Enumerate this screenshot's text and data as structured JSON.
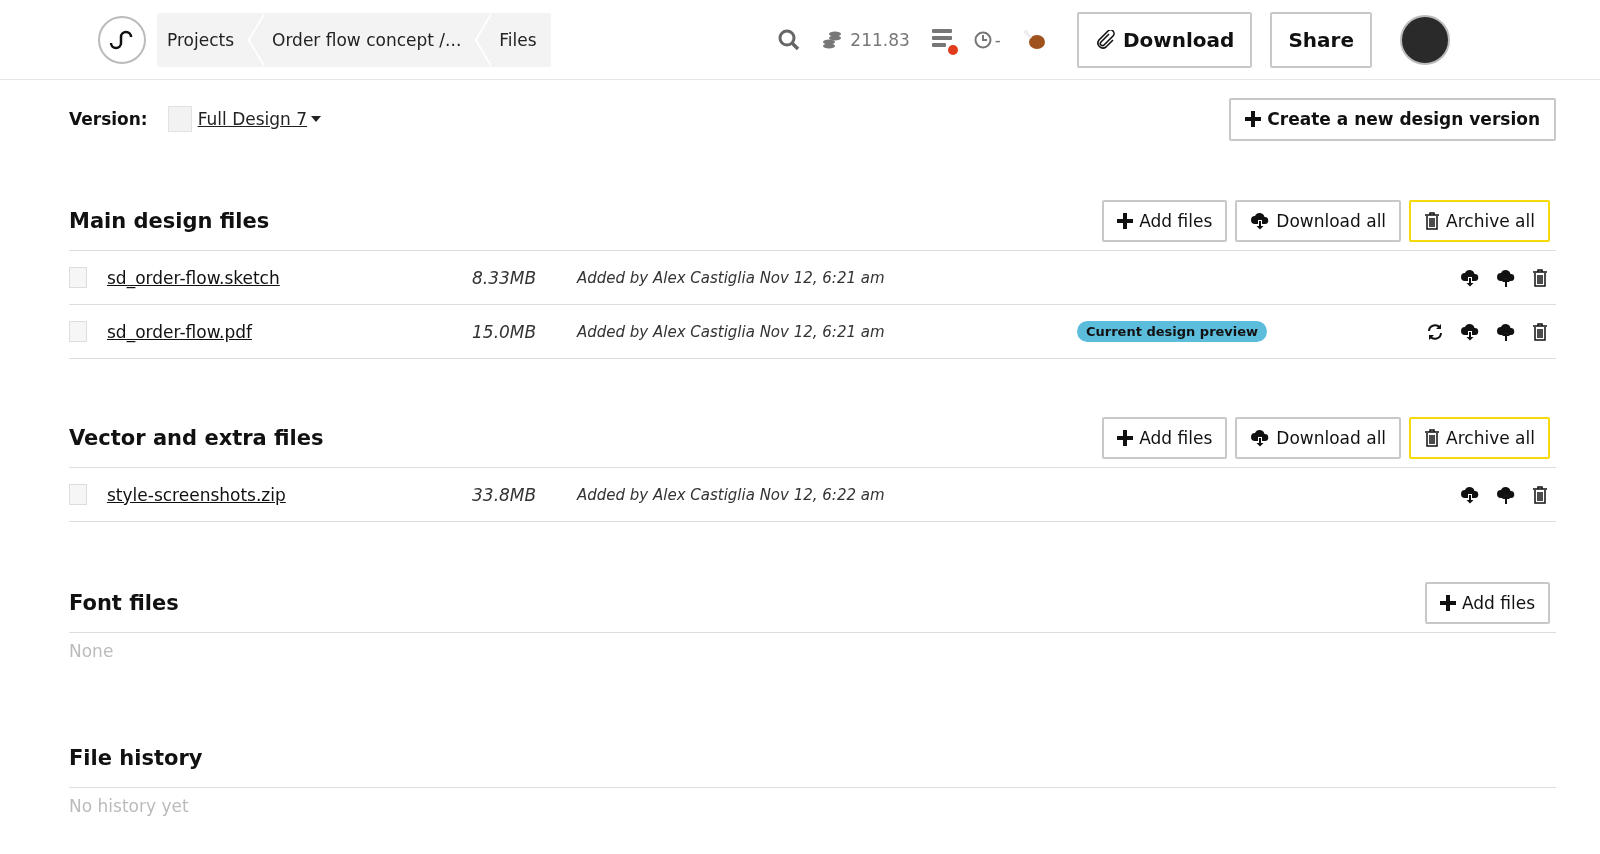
{
  "header": {
    "breadcrumbs": [
      {
        "label": "Projects"
      },
      {
        "label": "Order flow concept /..."
      },
      {
        "label": "Files"
      }
    ],
    "credits": "211.83",
    "timer": "-",
    "notification": true,
    "buttons": [
      {
        "label": "Download",
        "kind": "download"
      },
      {
        "label": "Share",
        "kind": "share"
      }
    ]
  },
  "version": {
    "label": "Version:",
    "value": "Full Design 7",
    "action": "Create a new design version"
  },
  "sections": [
    {
      "title": "Main design files",
      "buttons": [
        {
          "label": "Add files",
          "kind": "add"
        },
        {
          "label": "Download all",
          "kind": "download"
        },
        {
          "label": "Archive all",
          "kind": "archive"
        }
      ],
      "files": [
        {
          "name": "sd_order-flow.sketch",
          "size": "8.33MB",
          "added": "Added by Alex Castiglia Nov 12, 6:21 am",
          "actions": [
            {
              "kind": "download"
            },
            {
              "kind": "upload"
            },
            {
              "kind": "delete"
            }
          ]
        },
        {
          "name": "sd_order-flow.pdf",
          "size": "15.0MB",
          "added": "Added by Alex Castiglia Nov 12, 6:21 am",
          "badge": "Current design preview",
          "actions": [
            {
              "kind": "refresh"
            },
            {
              "kind": "download"
            },
            {
              "kind": "upload"
            },
            {
              "kind": "delete"
            }
          ]
        }
      ]
    },
    {
      "title": "Vector and extra files",
      "buttons": [
        {
          "label": "Add files",
          "kind": "add"
        },
        {
          "label": "Download all",
          "kind": "download"
        },
        {
          "label": "Archive all",
          "kind": "archive"
        }
      ],
      "files": [
        {
          "name": "style-screenshots.zip",
          "size": "33.8MB",
          "added": "Added by Alex Castiglia Nov 12, 6:22 am",
          "actions": [
            {
              "kind": "download"
            },
            {
              "kind": "upload"
            },
            {
              "kind": "delete"
            }
          ]
        }
      ]
    },
    {
      "title": "Font files",
      "buttons": [
        {
          "label": "Add files",
          "kind": "add"
        }
      ],
      "empty": "None"
    },
    {
      "title": "File history",
      "empty": "No history yet"
    }
  ]
}
